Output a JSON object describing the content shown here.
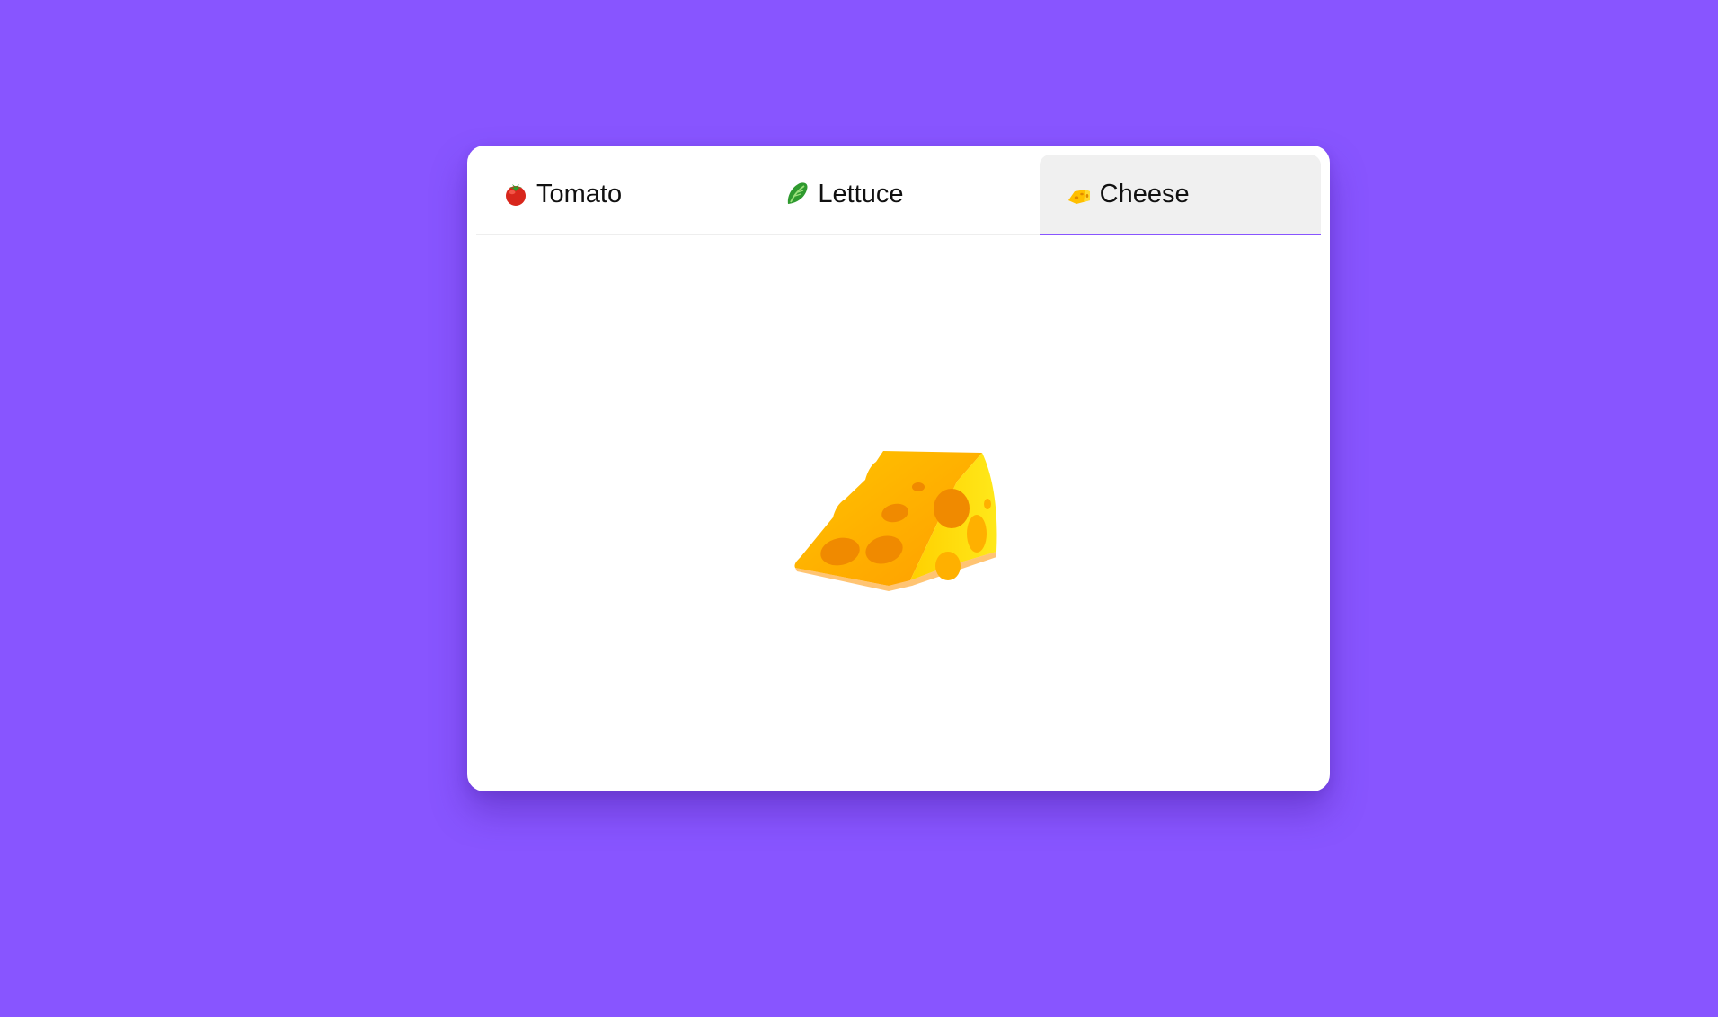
{
  "tabs": [
    {
      "label": "Tomato",
      "icon": "tomato-icon",
      "active": false
    },
    {
      "label": "Lettuce",
      "icon": "lettuce-icon",
      "active": false
    },
    {
      "label": "Cheese",
      "icon": "cheese-icon",
      "active": true
    }
  ],
  "content": {
    "icon": "cheese-icon"
  },
  "colors": {
    "background": "#8855ff",
    "accent": "#8855ff",
    "active_tab_bg": "#f0f0f0"
  }
}
